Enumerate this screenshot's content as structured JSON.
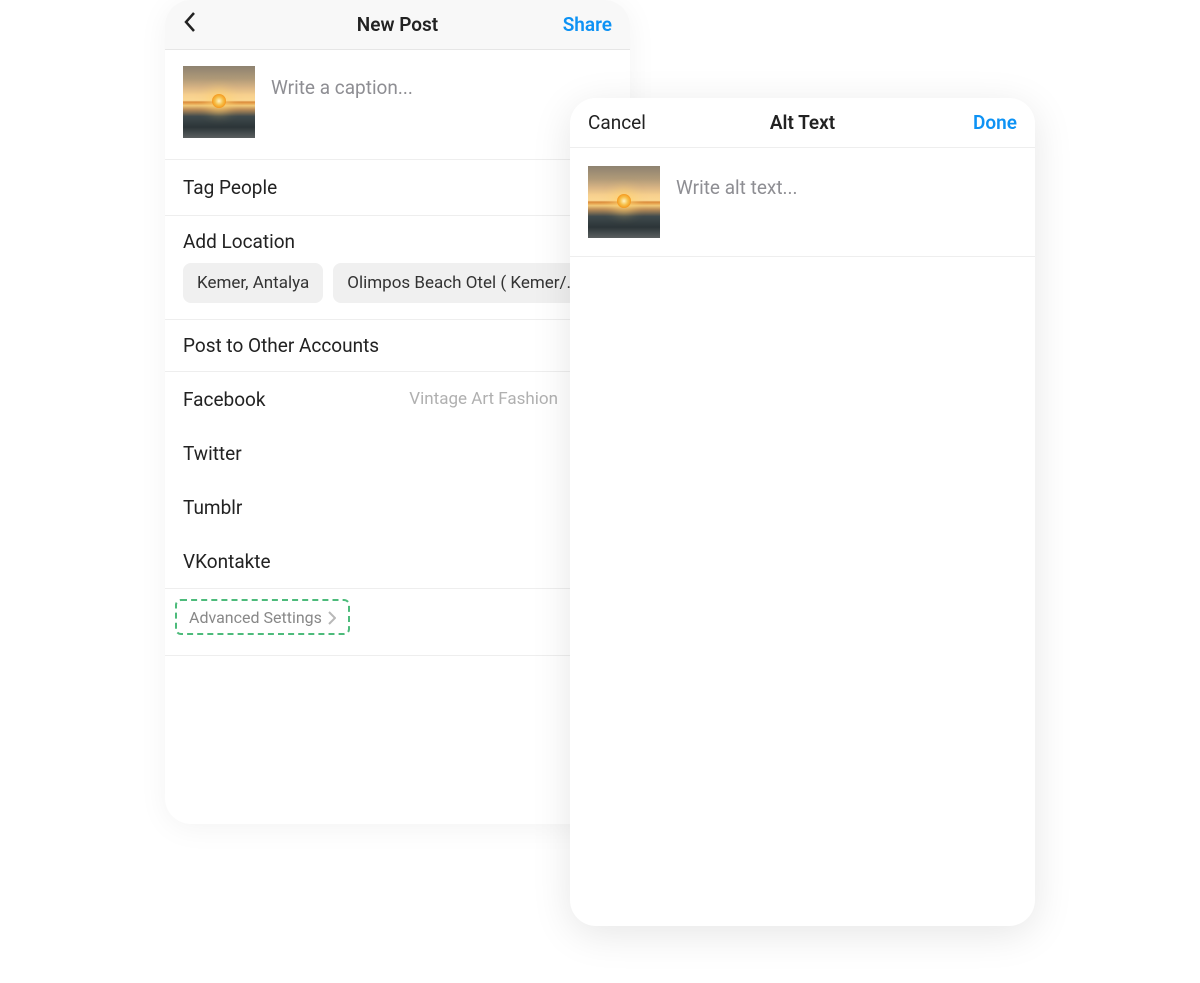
{
  "phone1": {
    "header": {
      "title": "New Post",
      "share": "Share"
    },
    "caption_placeholder": "Write a caption...",
    "rows": {
      "tag_people": "Tag People",
      "add_location": "Add Location",
      "post_other": "Post to Other Accounts",
      "advanced": "Advanced Settings"
    },
    "location_chips": [
      "Kemer, Antalya",
      "Olimpos Beach Otel ( Kemer/Ant..."
    ],
    "socials": [
      {
        "label": "Facebook",
        "sublabel": "Vintage Art Fashion"
      },
      {
        "label": "Twitter"
      },
      {
        "label": "Tumblr"
      },
      {
        "label": "VKontakte"
      }
    ]
  },
  "phone2": {
    "header": {
      "cancel": "Cancel",
      "title": "Alt Text",
      "done": "Done"
    },
    "alt_placeholder": "Write alt text..."
  }
}
